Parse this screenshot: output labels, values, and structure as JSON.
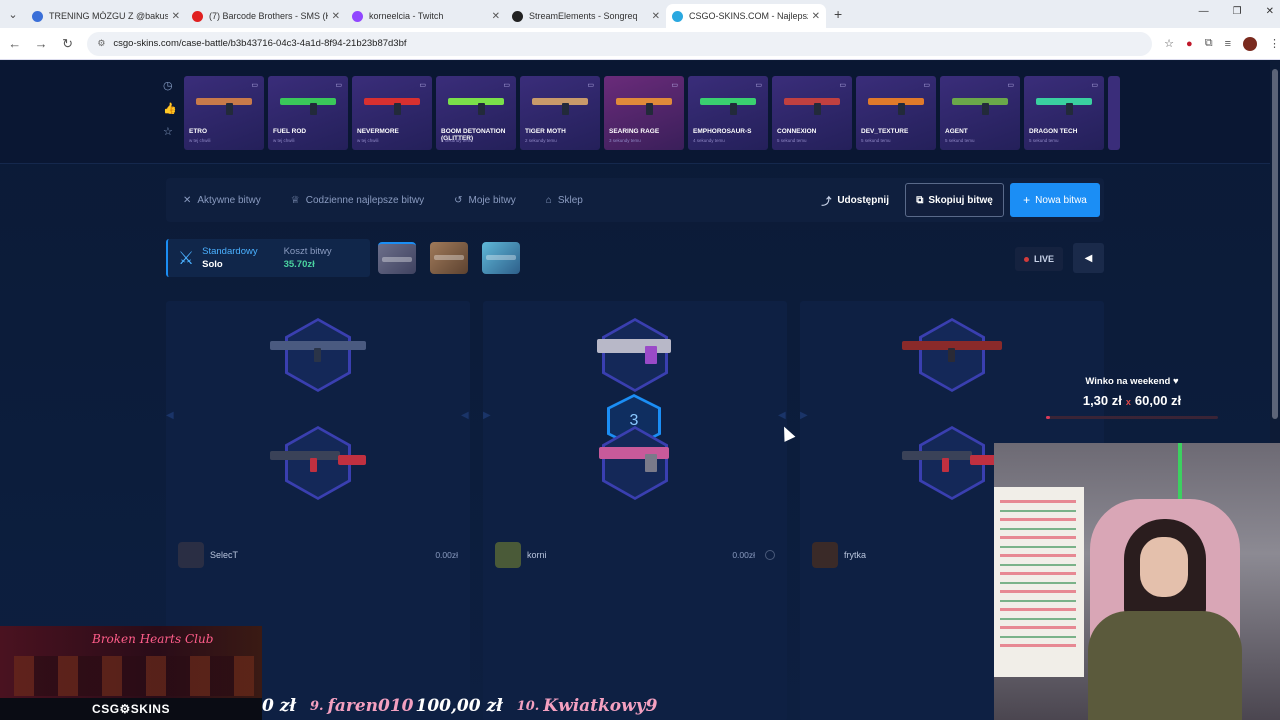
{
  "browser": {
    "tabs": [
      {
        "title": "TRENING MÓZGU Z @bakusio",
        "color": "#3a6fd8",
        "active": false
      },
      {
        "title": "(7) Barcode Brothers - SMS (Kri",
        "color": "#e02020",
        "active": false
      },
      {
        "title": "korneelcia - Twitch",
        "color": "#9146ff",
        "active": false
      },
      {
        "title": "StreamElements - Songreq",
        "color": "#222222",
        "active": false
      },
      {
        "title": "CSGO-SKINS.COM - Najlepsze",
        "color": "#2aa8e0",
        "active": true
      }
    ],
    "url": "csgo-skins.com/case-battle/b3b43716-04c3-4a1d-8f94-21b23b87d3bf"
  },
  "live_drops": [
    {
      "name": "ETRO",
      "sub": "w tej chwili",
      "pink": false,
      "c": "#c87a4a"
    },
    {
      "name": "FUEL ROD",
      "sub": "w tej chwili",
      "pink": false,
      "c": "#3ac85a"
    },
    {
      "name": "NEVERMORE",
      "sub": "w tej chwili",
      "pink": false,
      "c": "#d83030"
    },
    {
      "name": "BOOM DETONATION (GLITTER)",
      "sub": "2 sekundy temu",
      "pink": false,
      "c": "#7ae04a"
    },
    {
      "name": "TIGER MOTH",
      "sub": "2 sekundy temu",
      "pink": false,
      "c": "#c89a6a"
    },
    {
      "name": "SEARING RAGE",
      "sub": "3 sekundy temu",
      "pink": true,
      "c": "#e08a3a"
    },
    {
      "name": "EMPHOROSAUR-S",
      "sub": "4 sekundy temu",
      "pink": false,
      "c": "#3ad070"
    },
    {
      "name": "CONNEXION",
      "sub": "5 sekund temu",
      "pink": false,
      "c": "#c04040"
    },
    {
      "name": "DEV_TEXTURE",
      "sub": "5 sekund temu",
      "pink": false,
      "c": "#e07a2a"
    },
    {
      "name": "AGENT",
      "sub": "5 sekund temu",
      "pink": false,
      "c": "#6aa84a"
    },
    {
      "name": "DRAGON TECH",
      "sub": "5 sekund temu",
      "pink": false,
      "c": "#3ad0a0"
    }
  ],
  "nav": {
    "active_battles": "Aktywne bitwy",
    "daily_best": "Codzienne najlepsze bitwy",
    "my_battles": "Moje bitwy",
    "shop": "Sklep",
    "share": "Udostępnij",
    "copy": "Skopiuj bitwę",
    "new": "Nowa bitwa"
  },
  "mode": {
    "type": "Standardowy",
    "players": "Solo",
    "cost_label": "Koszt bitwy",
    "cost_value": "35.70zł"
  },
  "live_label": "LIVE",
  "round": "3",
  "players": [
    {
      "name": "SelecT",
      "value": "0.00zł"
    },
    {
      "name": "korni",
      "value": "0.00zł"
    },
    {
      "name": "frytka",
      "value": ""
    }
  ],
  "donation": {
    "title": "Winko na weekend ♥",
    "current": "1,30 zł",
    "sep": "x",
    "goal": "60,00 zł",
    "progress": 0.022
  },
  "overlay": {
    "game_title": "Broken Hearts Club",
    "brand": "CSG⚙SKINS",
    "ticker": [
      {
        "type": "amt",
        "text": "0 zł"
      },
      {
        "type": "rank",
        "text": "9."
      },
      {
        "type": "name",
        "text": "faren010"
      },
      {
        "type": "amt",
        "text": "100,00 zł"
      },
      {
        "type": "rank",
        "text": "10."
      },
      {
        "type": "name",
        "text": "Kwiatkowy9"
      }
    ]
  },
  "colors": {
    "accent": "#1b8ef5",
    "cost": "#4bd3a0",
    "live_dot": "#d43b3b"
  }
}
